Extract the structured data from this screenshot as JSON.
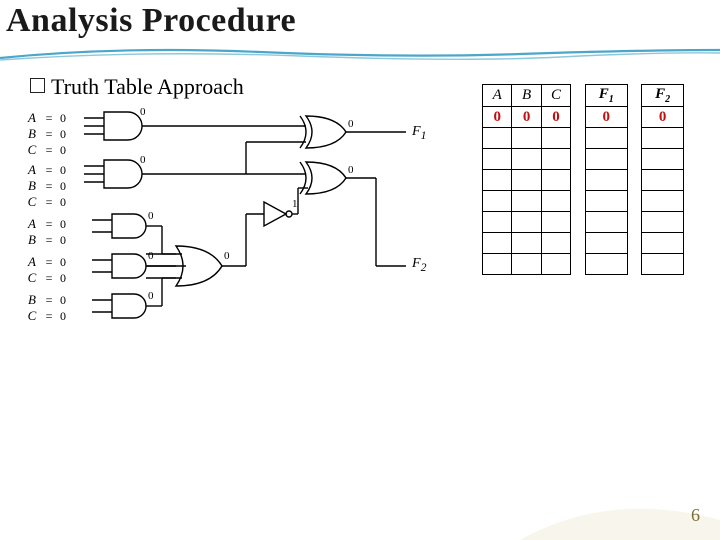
{
  "title": "Analysis Procedure",
  "bullet": "Truth Table Approach",
  "inputs": [
    {
      "var": "A",
      "val": "0"
    },
    {
      "var": "B",
      "val": "0"
    },
    {
      "var": "C",
      "val": "0"
    },
    {
      "var": "A",
      "val": "0"
    },
    {
      "var": "B",
      "val": "0"
    },
    {
      "var": "C",
      "val": "0"
    },
    {
      "var": "A",
      "val": "0"
    },
    {
      "var": "B",
      "val": "0"
    },
    {
      "var": "A",
      "val": "0"
    },
    {
      "var": "C",
      "val": "0"
    },
    {
      "var": "B",
      "val": "0"
    },
    {
      "var": "C",
      "val": "0"
    }
  ],
  "gate_vals": {
    "g1_out": "0",
    "g2_out": "0",
    "g3_out": "0",
    "g4_out": "0",
    "g5_out": "0",
    "xor_top": "0",
    "xor_bot": "0",
    "inv_out": "1",
    "or_out": "0"
  },
  "outputs": {
    "f1": "F",
    "f1_sub": "1",
    "f2": "F",
    "f2_sub": "2"
  },
  "truth": {
    "headers": {
      "a": "A",
      "b": "B",
      "c": "C",
      "f1": "F",
      "f1_sub": "1",
      "f2": "F",
      "f2_sub": "2"
    },
    "rows": [
      {
        "a": "0",
        "b": "0",
        "c": "0",
        "f1": "0",
        "f2": "0"
      },
      {},
      {},
      {},
      {},
      {},
      {},
      {}
    ]
  },
  "page_number": "6",
  "icons": {
    "and": "and-gate",
    "or": "or-gate",
    "xor": "xor-gate",
    "not": "not-gate"
  }
}
